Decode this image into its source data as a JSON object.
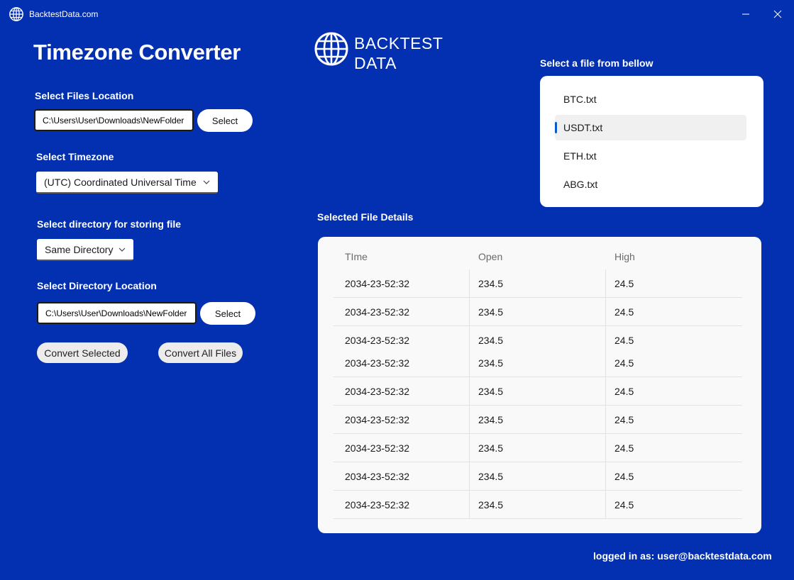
{
  "window": {
    "title": "BacktestData.com"
  },
  "header": {
    "title": "Timezone Converter",
    "logo_line1": "BACKTEST",
    "logo_line2": "DATA"
  },
  "files_location": {
    "label": "Select Files Location",
    "path": "C:\\Users\\User\\Downloads\\NewFolder",
    "button": "Select"
  },
  "timezone": {
    "label": "Select Timezone",
    "selected": "(UTC) Coordinated Universal Time"
  },
  "storage": {
    "label": "Select directory for storing file",
    "selected": "Same Directory"
  },
  "directory_location": {
    "label": "Select Directory Location",
    "path": "C:\\Users\\User\\Downloads\\NewFolder",
    "button": "Select"
  },
  "actions": {
    "convert_selected": "Convert Selected",
    "convert_all": "Convert All Files"
  },
  "file_list": {
    "label": "Select a file from bellow",
    "items": [
      "BTC.txt",
      "USDT.txt",
      "ETH.txt",
      "ABG.txt"
    ],
    "selected_index": 1
  },
  "details": {
    "label": "Selected File Details",
    "columns": [
      "TIme",
      "Open",
      "High"
    ],
    "rows": [
      [
        "2034-23-52:32",
        "234.5",
        "24.5"
      ],
      [
        "2034-23-52:32",
        "234.5",
        "24.5"
      ],
      [
        "2034-23-52:32",
        "234.5",
        "24.5"
      ],
      [
        "2034-23-52:32",
        "234.5",
        "24.5"
      ],
      [
        "2034-23-52:32",
        "234.5",
        "24.5"
      ],
      [
        "2034-23-52:32",
        "234.5",
        "24.5"
      ],
      [
        "2034-23-52:32",
        "234.5",
        "24.5"
      ],
      [
        "2034-23-52:32",
        "234.5",
        "24.5"
      ],
      [
        "2034-23-52:32",
        "234.5",
        "24.5"
      ]
    ]
  },
  "footer": {
    "text": "logged in as: user@backtestdata.com"
  },
  "colors": {
    "background": "#0230b0",
    "selection_indicator": "#0a5ad0"
  }
}
